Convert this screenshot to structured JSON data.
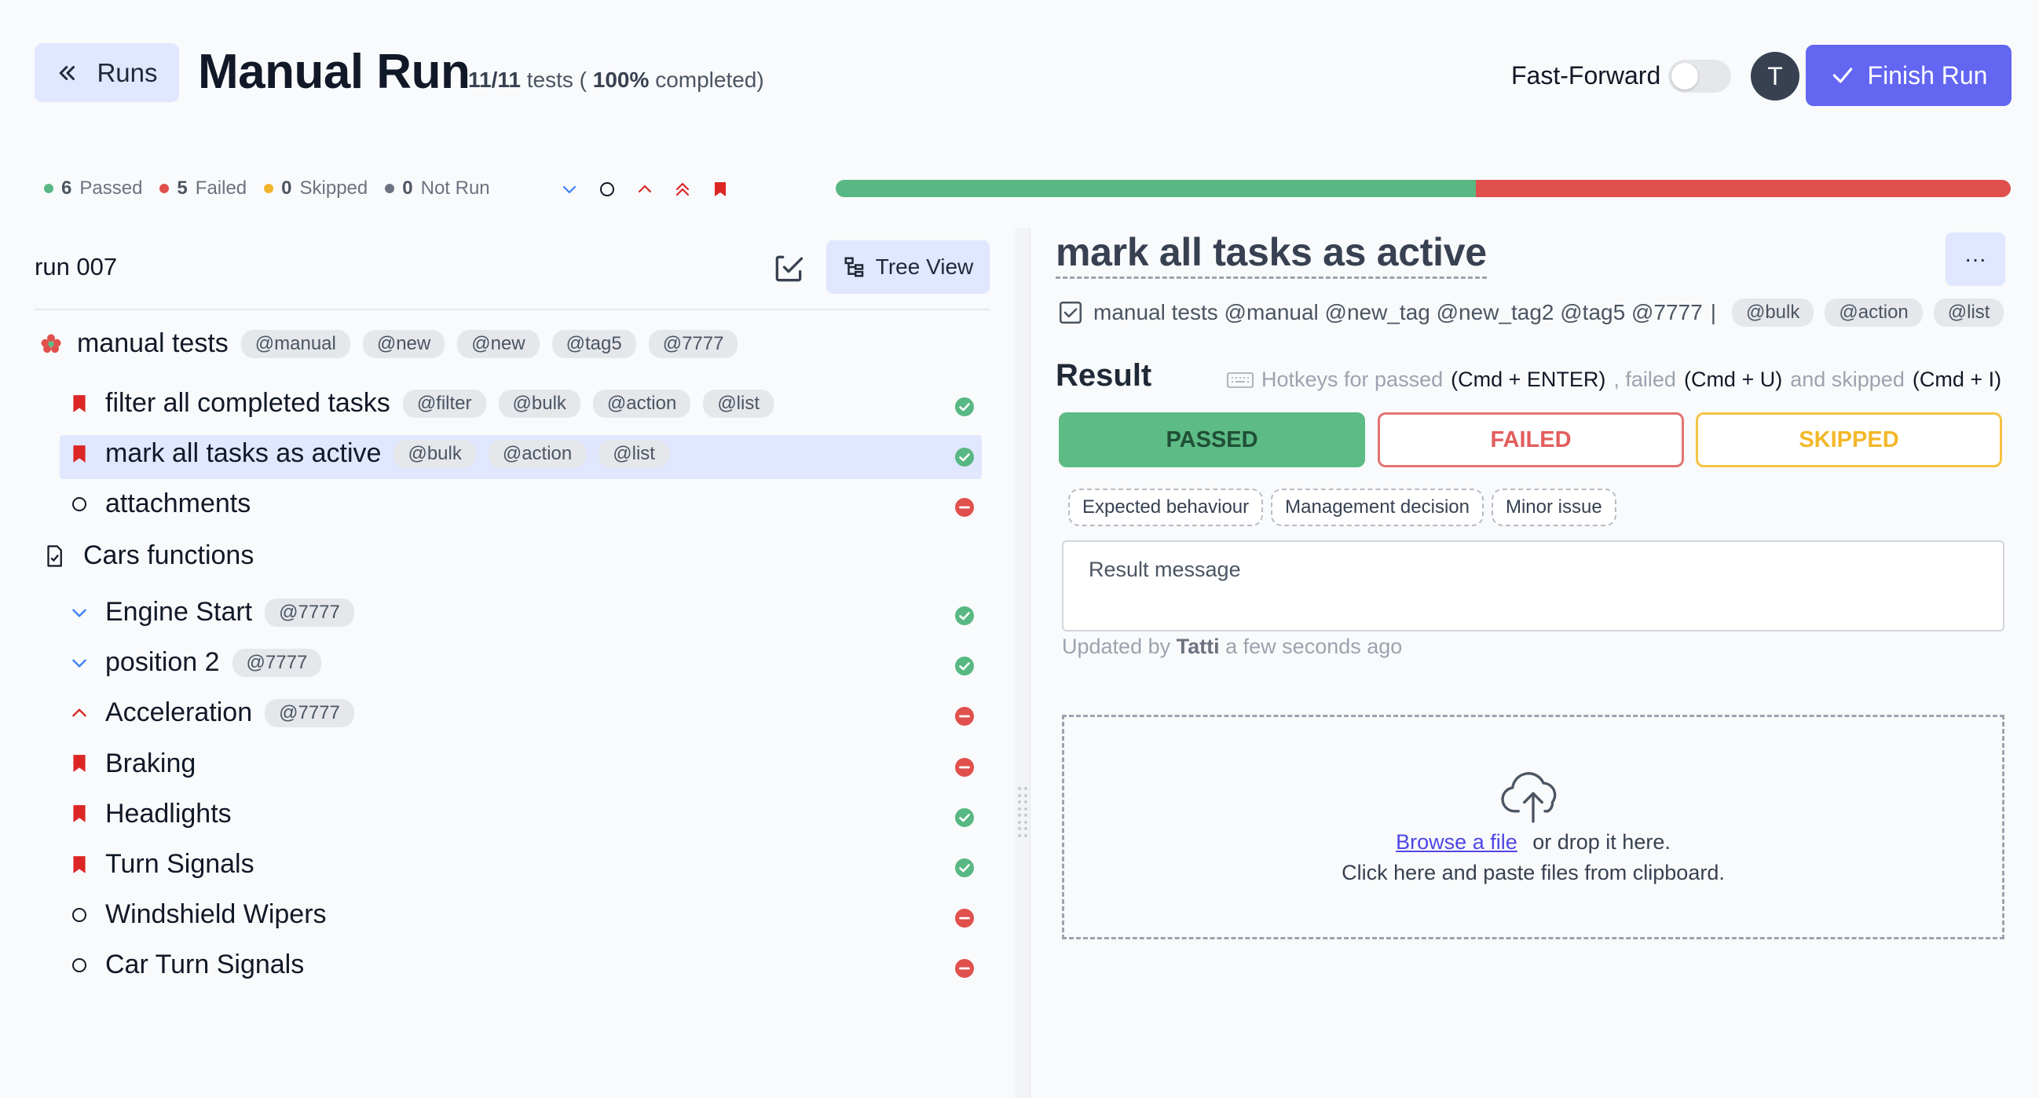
{
  "header": {
    "back_label": "Runs",
    "title": "Manual Run",
    "tests_count": "11/11",
    "tests_word": "tests (",
    "percent": "100%",
    "completed_word": "completed)",
    "fast_forward_label": "Fast-Forward",
    "fast_forward_on": false,
    "avatar_initial": "T",
    "finish_label": "Finish Run"
  },
  "stats": {
    "passed_count": "6",
    "passed_label": "Passed",
    "failed_count": "5",
    "failed_label": "Failed",
    "skipped_count": "0",
    "skipped_label": "Skipped",
    "notrun_count": "0",
    "notrun_label": "Not Run",
    "passed_fraction": 0.545,
    "failed_fraction": 0.455
  },
  "colors": {
    "passed": "#58b883",
    "failed": "#e0504c",
    "skipped": "#f0b429",
    "notrun": "#6b7280",
    "accent": "#6366f1"
  },
  "left": {
    "run_name": "run 007",
    "tree_view_label": "Tree View",
    "suite1": {
      "name": "manual tests",
      "tags": [
        "@manual",
        "@new",
        "@new",
        "@tag5",
        "@7777"
      ]
    },
    "tests1": [
      {
        "name": "filter all completed tasks",
        "tags": [
          "@filter",
          "@bulk",
          "@action",
          "@list"
        ],
        "icon": "bookmark-icon",
        "status": "passed"
      },
      {
        "name": "mark all tasks as active",
        "tags": [
          "@bulk",
          "@action",
          "@list"
        ],
        "icon": "bookmark-icon",
        "status": "passed"
      },
      {
        "name": "attachments",
        "tags": [],
        "icon": "circle-icon",
        "status": "failed"
      }
    ],
    "suite2": {
      "name": "Cars functions"
    },
    "tests2": [
      {
        "name": "Engine Start",
        "tags": [
          "@7777"
        ],
        "icon": "chevron-down-icon",
        "status": "passed"
      },
      {
        "name": "position 2",
        "tags": [
          "@7777"
        ],
        "icon": "chevron-down-icon",
        "status": "passed"
      },
      {
        "name": "Acceleration",
        "tags": [
          "@7777"
        ],
        "icon": "chevron-up-icon",
        "status": "failed"
      },
      {
        "name": "Braking",
        "tags": [],
        "icon": "bookmark-icon",
        "status": "failed"
      },
      {
        "name": "Headlights",
        "tags": [],
        "icon": "bookmark-icon",
        "status": "passed"
      },
      {
        "name": "Turn Signals",
        "tags": [],
        "icon": "bookmark-icon",
        "status": "passed"
      },
      {
        "name": "Windshield Wipers",
        "tags": [],
        "icon": "circle-icon",
        "status": "failed"
      },
      {
        "name": "Car Turn Signals",
        "tags": [],
        "icon": "circle-icon",
        "status": "failed"
      }
    ]
  },
  "detail": {
    "title": "mark all tasks as active",
    "more_label": "···",
    "meta_text": "manual tests @manual @new_tag @new_tag2 @tag5 @7777",
    "meta_sep": "|",
    "meta_tags": [
      "@bulk",
      "@action",
      "@list"
    ],
    "result_label": "Result",
    "hotkeys": {
      "prefix": "Hotkeys for passed",
      "passed_key": "(Cmd + ENTER)",
      "mid1": ", failed",
      "failed_key": "(Cmd + U)",
      "mid2": "and skipped",
      "skipped_key": "(Cmd + I)"
    },
    "passed_label": "PASSED",
    "failed_label": "FAILED",
    "skipped_label": "SKIPPED",
    "chips": [
      "Expected behaviour",
      "Management decision",
      "Minor issue"
    ],
    "message_placeholder": "Result message",
    "updated_prefix": "Updated by",
    "updated_user": "Tatti",
    "updated_time": "a few seconds ago",
    "browse_label": "Browse a file",
    "drop_text": "or drop it here.",
    "paste_text": "Click here and paste files from clipboard."
  }
}
